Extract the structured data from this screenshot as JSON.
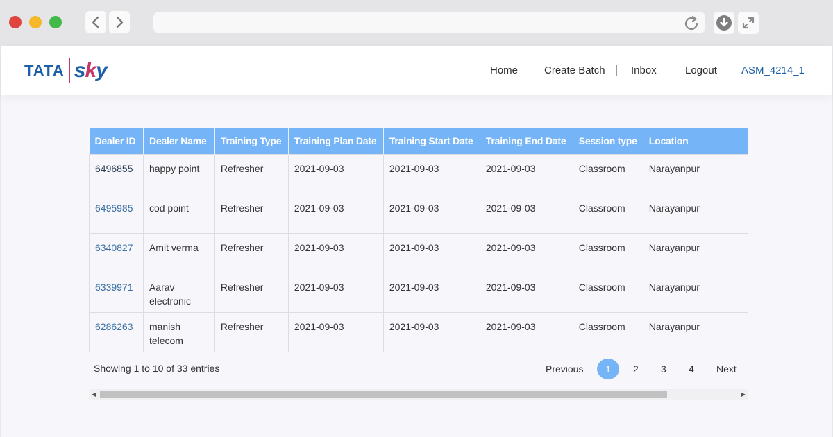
{
  "browser": {
    "back_icon": "chevron-left-icon",
    "forward_icon": "chevron-right-icon",
    "reload_icon": "reload-icon",
    "download_icon": "download-icon",
    "expand_icon": "expand-icon"
  },
  "header": {
    "logo": {
      "brand_left": "TATA",
      "brand_right_a": "s",
      "brand_right_b": "k",
      "brand_right_c": "y"
    },
    "nav": [
      "Home",
      "Create Batch",
      "Inbox",
      "Logout"
    ],
    "user": "ASM_4214_1"
  },
  "table": {
    "columns": [
      "Dealer ID",
      "Dealer Name",
      "Training Type",
      "Training Plan Date",
      "Training Start Date",
      "Training End Date",
      "Session type",
      "Location"
    ],
    "rows": [
      [
        "6496855",
        "happy point",
        "Refresher",
        "2021-09-03",
        "2021-09-03",
        "2021-09-03",
        "Classroom",
        "Narayanpur"
      ],
      [
        "6495985",
        "cod point",
        "Refresher",
        "2021-09-03",
        "2021-09-03",
        "2021-09-03",
        "Classroom",
        "Narayanpur"
      ],
      [
        "6340827",
        "Amit verma",
        "Refresher",
        "2021-09-03",
        "2021-09-03",
        "2021-09-03",
        "Classroom",
        "Narayanpur"
      ],
      [
        "6339971",
        "Aarav electronic",
        "Refresher",
        "2021-09-03",
        "2021-09-03",
        "2021-09-03",
        "Classroom",
        "Narayanpur"
      ],
      [
        "6286263",
        "manish telecom",
        "Refresher",
        "2021-09-03",
        "2021-09-03",
        "2021-09-03",
        "Classroom",
        "Narayanpur"
      ]
    ]
  },
  "footer": {
    "info": "Showing 1 to 10 of 33 entries",
    "pagination": {
      "previous": "Previous",
      "pages": [
        "1",
        "2",
        "3",
        "4"
      ],
      "next": "Next",
      "current": "1"
    }
  },
  "colors": {
    "accent": "#75b4f6",
    "brand": "#1d5fa8",
    "brand_pink": "#c43768"
  }
}
